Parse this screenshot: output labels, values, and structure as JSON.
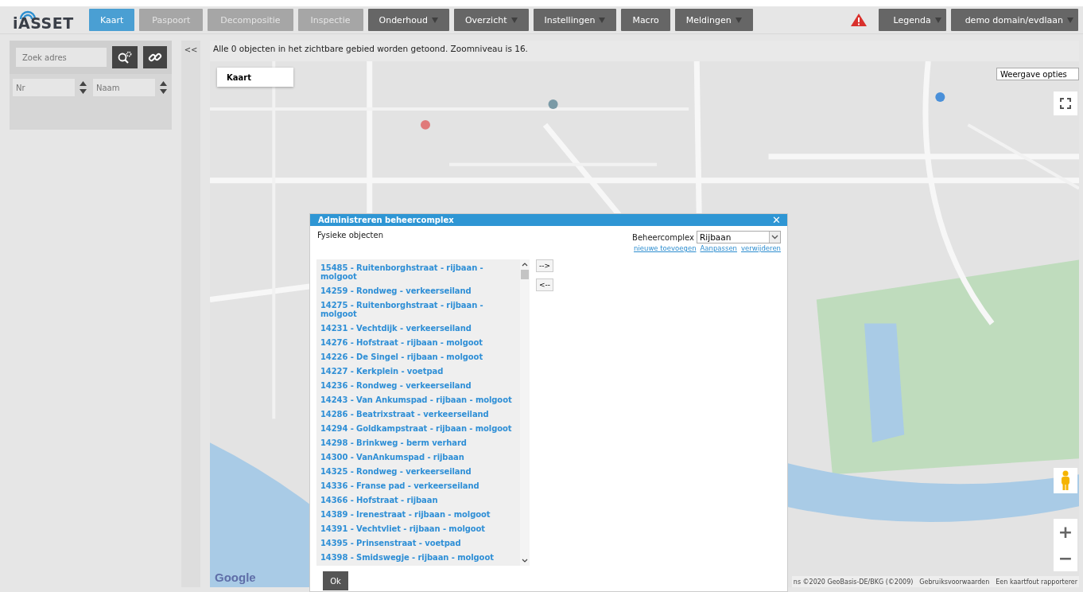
{
  "logo": "iASSET",
  "nav": [
    {
      "label": "Kaart",
      "selected": true,
      "disabled": false,
      "dropdown": false
    },
    {
      "label": "Paspoort",
      "selected": false,
      "disabled": true,
      "dropdown": false
    },
    {
      "label": "Decompositie",
      "selected": false,
      "disabled": true,
      "dropdown": false
    },
    {
      "label": "Inspectie",
      "selected": false,
      "disabled": true,
      "dropdown": false
    },
    {
      "label": "Onderhoud",
      "selected": false,
      "disabled": false,
      "dropdown": true
    },
    {
      "label": "Overzicht",
      "selected": false,
      "disabled": false,
      "dropdown": true
    },
    {
      "label": "Instellingen",
      "selected": false,
      "disabled": false,
      "dropdown": true
    },
    {
      "label": "Macro",
      "selected": false,
      "disabled": false,
      "dropdown": false
    },
    {
      "label": "Meldingen",
      "selected": false,
      "disabled": false,
      "dropdown": true
    }
  ],
  "nav_right": [
    {
      "label": "Legenda",
      "dropdown": true
    },
    {
      "label": "demo domain/evdlaan",
      "dropdown": true
    }
  ],
  "sidebar": {
    "search": {
      "placeholder": "Zoek adres"
    },
    "filters": [
      {
        "placeholder": "Nr"
      },
      {
        "placeholder": "Naam"
      }
    ]
  },
  "collapse_button": "<<",
  "map": {
    "info": "Alle 0 objecten in het zichtbare gebied worden getoond. Zoomniveau is 16.",
    "type_select": "Kaart",
    "options_select": "Weergave opties",
    "logo": "Google",
    "attribution": [
      "ns ©2020 GeoBasis-DE/BKG (©2009)",
      "Gebruiksvoorwaarden",
      "Een kaartfout rapporterer"
    ],
    "zoom": [
      "+",
      "−"
    ]
  },
  "dialog": {
    "title": "Administreren beheercomplex",
    "close": "✕",
    "list_label": "Fysieke objecten",
    "complex_label": "Beheercomplex",
    "complex_value": "Rijbaan",
    "links": [
      "nieuwe toevoegen",
      "Aanpassen",
      "verwijderen"
    ],
    "move_buttons": [
      "-->",
      "<--"
    ],
    "items": [
      "15485 - Ruitenborghstraat - rijbaan - molgoot",
      "14259 - Rondweg - verkeerseiland",
      "14275 - Ruitenborghstraat - rijbaan - molgoot",
      "14231 - Vechtdijk - verkeerseiland",
      "14276 - Hofstraat - rijbaan - molgoot",
      "14226 - De Singel - rijbaan - molgoot",
      "14227 - Kerkplein - voetpad",
      "14236 - Rondweg - verkeerseiland",
      "14243 - Van Ankumspad - rijbaan - molgoot",
      "14286 - Beatrixstraat - verkeerseiland",
      "14294 - Goldkampstraat - rijbaan - molgoot",
      "14298 - Brinkweg - berm verhard",
      "14300 - VanAnkumspad - rijbaan",
      "14325 - Rondweg - verkeerseiland",
      "14336 - Franse pad - verkeerseiland",
      "14366 - Hofstraat - rijbaan",
      "14389 - Irenestraat - rijbaan - molgoot",
      "14391 - Vechtvliet - rijbaan - molgoot",
      "14395 - Prinsenstraat - voetpad",
      "14398 - Smidswegje - rijbaan - molgoot"
    ],
    "ok": "Ok"
  }
}
